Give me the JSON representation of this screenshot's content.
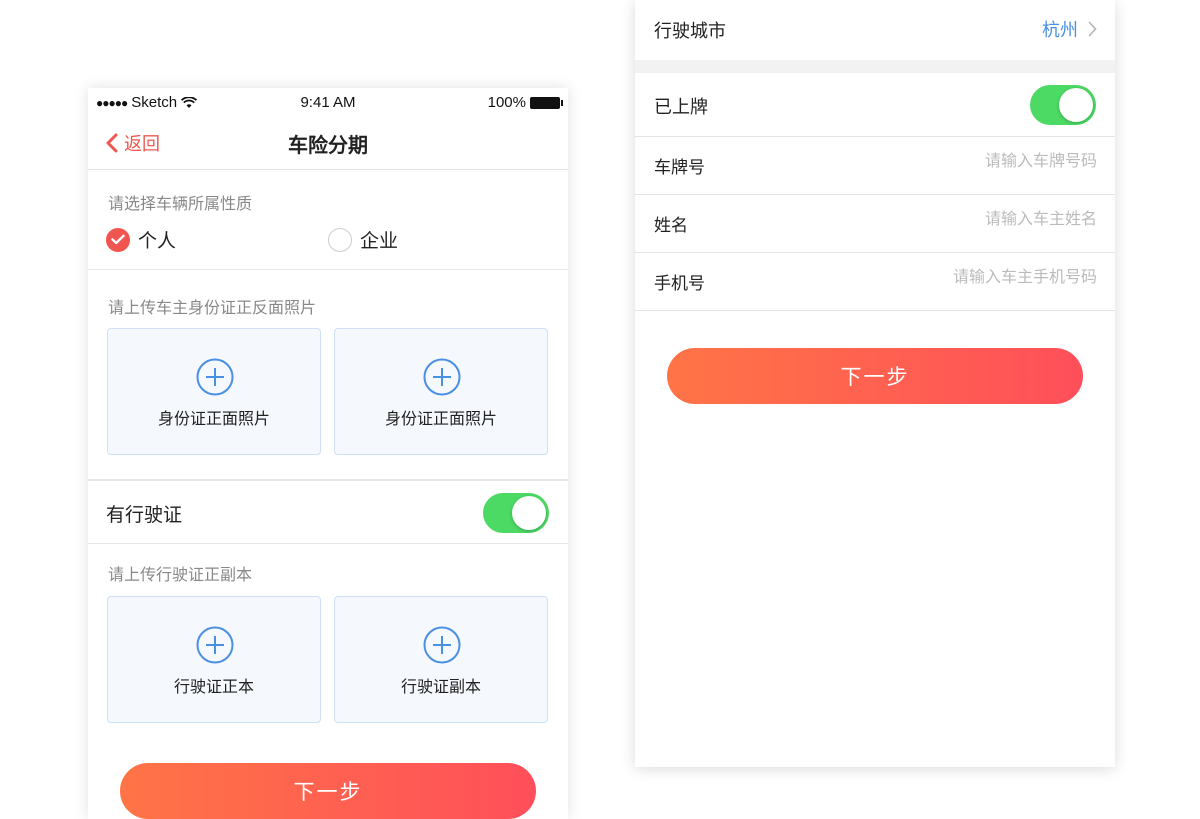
{
  "left": {
    "status": {
      "carrier": "Sketch",
      "time": "9:41 AM",
      "battery": "100%"
    },
    "nav": {
      "back_label": "返回",
      "title": "车险分期"
    },
    "nature": {
      "hint": "请选择车辆所属性质",
      "options": [
        {
          "label": "个人",
          "checked": true
        },
        {
          "label": "企业",
          "checked": false
        }
      ]
    },
    "id_upload": {
      "hint": "请上传车主身份证正反面照片",
      "front_label": "身份证正面照片",
      "back_label": "身份证正面照片"
    },
    "license": {
      "label": "有行驶证",
      "enabled": true
    },
    "license_upload": {
      "hint": "请上传行驶证正副本",
      "main_label": "行驶证正本",
      "copy_label": "行驶证副本"
    },
    "next_label": "下一步"
  },
  "right": {
    "city": {
      "label": "行驶城市",
      "value": "杭州"
    },
    "plated": {
      "label": "已上牌",
      "enabled": true
    },
    "fields": [
      {
        "label": "车牌号",
        "placeholder": "请输入车牌号码",
        "value": ""
      },
      {
        "label": "姓名",
        "placeholder": "请输入车主姓名",
        "value": ""
      },
      {
        "label": "手机号",
        "placeholder": "请输入车主手机号码",
        "value": ""
      }
    ],
    "next_label": "下一步"
  },
  "colors": {
    "accent": "#f0564f",
    "toggle_on": "#4cd964",
    "link_blue": "#4a90e2",
    "gradient_start": "#ff7446",
    "gradient_end": "#ff4f5a"
  },
  "icons": [
    "chevron-left-icon",
    "check-icon",
    "plus-circle-icon",
    "chevron-right-icon",
    "wifi-icon",
    "battery-icon",
    "signal-dots-icon"
  ]
}
